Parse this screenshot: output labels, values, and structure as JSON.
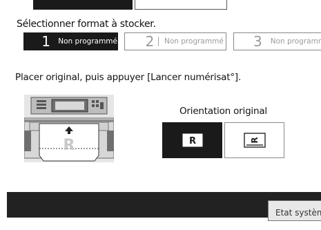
{
  "format_section": {
    "label": "Sélectionner format à stocker.",
    "programs": [
      {
        "number": "1",
        "label": "Non programmé",
        "active": true
      },
      {
        "number": "2",
        "label": "Non programmé",
        "active": false
      },
      {
        "number": "3",
        "label": "Non programm",
        "active": false
      }
    ]
  },
  "instruction": "Placer original, puis appuyer [Lancer numérisat°].",
  "orientation": {
    "label": "Orientation original",
    "options": [
      {
        "icon": "R",
        "name": "portrait",
        "active": true
      },
      {
        "icon": "R",
        "name": "landscape",
        "active": false
      }
    ]
  },
  "footer": {
    "status_button": "Etat systèm"
  },
  "colors": {
    "dark": "#1a1a1a",
    "bar": "#222222",
    "inactive_text": "#9a9a9a"
  }
}
